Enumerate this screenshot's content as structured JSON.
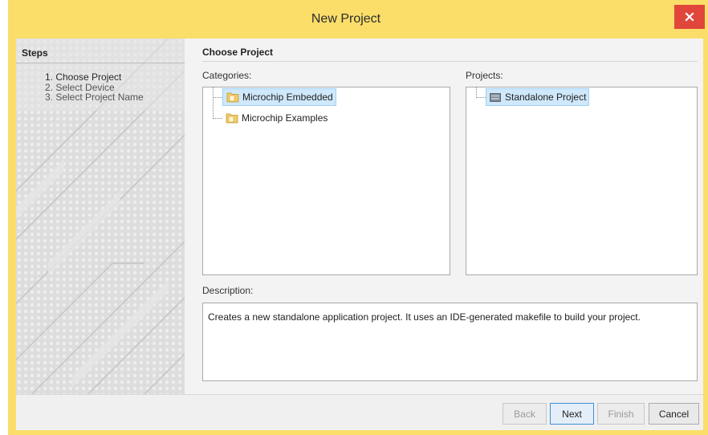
{
  "window": {
    "title": "New Project",
    "close_glyph": "×",
    "accent_color": "#fbdd6a",
    "close_color": "#e0463a"
  },
  "steps": {
    "header": "Steps",
    "items": [
      {
        "label": "1. Choose Project",
        "active": true
      },
      {
        "label": "2. Select Device",
        "active": false
      },
      {
        "label": "3. Select Project Name",
        "active": false
      }
    ]
  },
  "main": {
    "title": "Choose Project",
    "categories": {
      "label": "Categories:",
      "items": [
        {
          "label": "Microchip Embedded",
          "selected": true,
          "icon": "folder-icon"
        },
        {
          "label": "Microchip Examples",
          "selected": false,
          "icon": "folder-icon"
        }
      ]
    },
    "projects": {
      "label": "Projects:",
      "items": [
        {
          "label": "Standalone Project",
          "selected": true,
          "icon": "project-icon"
        }
      ]
    },
    "description": {
      "label": "Description:",
      "text": "Creates a new standalone application project. It uses an IDE-generated makefile to build your project."
    }
  },
  "footer": {
    "back_label": "Back",
    "next_label": "Next",
    "finish_label": "Finish",
    "cancel_label": "Cancel"
  }
}
